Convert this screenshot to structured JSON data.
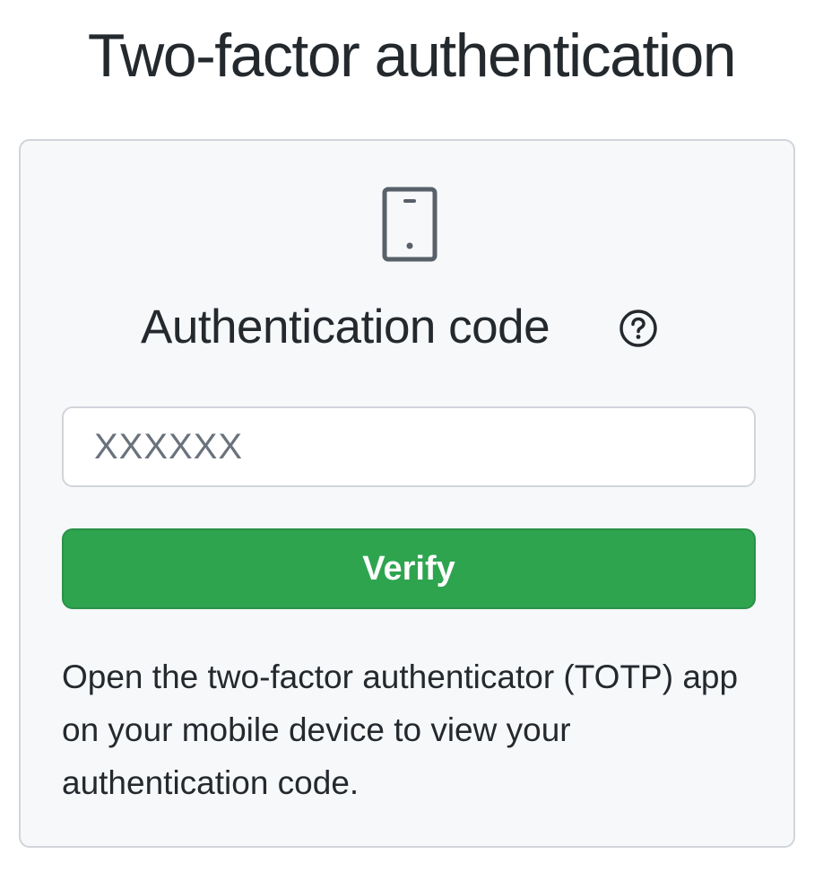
{
  "page": {
    "title": "Two-factor authentication"
  },
  "card": {
    "icon": "device-mobile-icon",
    "heading": "Authentication code",
    "help_icon": "question-circle-icon",
    "input": {
      "placeholder": "XXXXXX",
      "value": ""
    },
    "verify_label": "Verify",
    "help_text": "Open the two-factor authenticator (TOTP) app on your mobile device to view your authentication code."
  },
  "colors": {
    "primary_button": "#2ea44f",
    "card_background": "#f6f8fa",
    "border": "#d1d5da",
    "text": "#24292e",
    "muted": "#6a737d"
  }
}
